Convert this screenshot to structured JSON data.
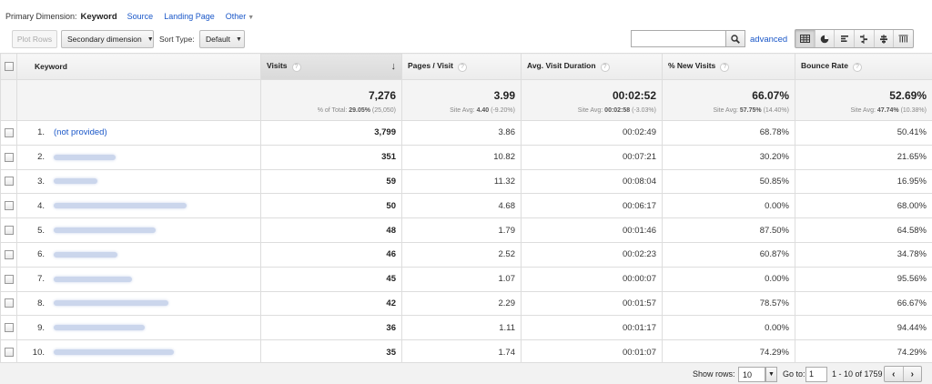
{
  "dimension_bar": {
    "label": "Primary Dimension:",
    "current": "Keyword",
    "links": [
      "Source",
      "Landing Page"
    ],
    "other": "Other"
  },
  "toolbar": {
    "plot_rows": "Plot Rows",
    "secondary_dimension": "Secondary dimension",
    "sort_type_label": "Sort Type:",
    "sort_type_value": "Default",
    "search_value": "",
    "advanced": "advanced",
    "view_icons": [
      "table-view-icon",
      "pie-view-icon",
      "performance-view-icon",
      "comparison-view-icon",
      "term-cloud-view-icon",
      "pivot-view-icon"
    ]
  },
  "columns": {
    "keyword": "Keyword",
    "visits": "Visits",
    "pages_visit": "Pages / Visit",
    "avg_duration": "Avg. Visit Duration",
    "new_visits": "% New Visits",
    "bounce_rate": "Bounce Rate"
  },
  "totals": {
    "visits": "7,276",
    "visits_sub_pre": "% of Total: ",
    "visits_sub_bold": "29.05%",
    "visits_sub_post": " (25,050)",
    "pages": "3.99",
    "pages_sub_pre": "Site Avg: ",
    "pages_sub_bold": "4.40",
    "pages_sub_post": " (-9.20%)",
    "duration": "00:02:52",
    "duration_sub_pre": "Site Avg: ",
    "duration_sub_bold": "00:02:58",
    "duration_sub_post": " (-3.03%)",
    "new": "66.07%",
    "new_sub_pre": "Site Avg: ",
    "new_sub_bold": "57.75%",
    "new_sub_post": " (14.40%)",
    "bounce": "52.69%",
    "bounce_sub_pre": "Site Avg: ",
    "bounce_sub_bold": "47.74%",
    "bounce_sub_post": " (10.38%)"
  },
  "rows": [
    {
      "idx": "1.",
      "keyword": "(not provided)",
      "blurred": false,
      "visits": "3,799",
      "pages": "3.86",
      "duration": "00:02:49",
      "new": "68.78%",
      "bounce": "50.41%"
    },
    {
      "idx": "2.",
      "keyword": "",
      "blurred": true,
      "visits": "351",
      "pages": "10.82",
      "duration": "00:07:21",
      "new": "30.20%",
      "bounce": "21.65%"
    },
    {
      "idx": "3.",
      "keyword": "",
      "blurred": true,
      "visits": "59",
      "pages": "11.32",
      "duration": "00:08:04",
      "new": "50.85%",
      "bounce": "16.95%"
    },
    {
      "idx": "4.",
      "keyword": "",
      "blurred": true,
      "visits": "50",
      "pages": "4.68",
      "duration": "00:06:17",
      "new": "0.00%",
      "bounce": "68.00%"
    },
    {
      "idx": "5.",
      "keyword": "",
      "blurred": true,
      "visits": "48",
      "pages": "1.79",
      "duration": "00:01:46",
      "new": "87.50%",
      "bounce": "64.58%"
    },
    {
      "idx": "6.",
      "keyword": "",
      "blurred": true,
      "visits": "46",
      "pages": "2.52",
      "duration": "00:02:23",
      "new": "60.87%",
      "bounce": "34.78%"
    },
    {
      "idx": "7.",
      "keyword": "",
      "blurred": true,
      "visits": "45",
      "pages": "1.07",
      "duration": "00:00:07",
      "new": "0.00%",
      "bounce": "95.56%"
    },
    {
      "idx": "8.",
      "keyword": "",
      "blurred": true,
      "visits": "42",
      "pages": "2.29",
      "duration": "00:01:57",
      "new": "78.57%",
      "bounce": "66.67%"
    },
    {
      "idx": "9.",
      "keyword": "",
      "blurred": true,
      "visits": "36",
      "pages": "1.11",
      "duration": "00:01:17",
      "new": "0.00%",
      "bounce": "94.44%"
    },
    {
      "idx": "10.",
      "keyword": "",
      "blurred": true,
      "visits": "35",
      "pages": "1.74",
      "duration": "00:01:07",
      "new": "74.29%",
      "bounce": "74.29%"
    }
  ],
  "footer": {
    "show_rows_label": "Show rows:",
    "show_rows_value": "10",
    "goto_label": "Go to:",
    "goto_value": "1",
    "range": "1 - 10 of 1759"
  },
  "colors": {
    "link": "#1a57c8",
    "header_bg": "#ececec",
    "totals_bg": "#f4f4f4"
  }
}
